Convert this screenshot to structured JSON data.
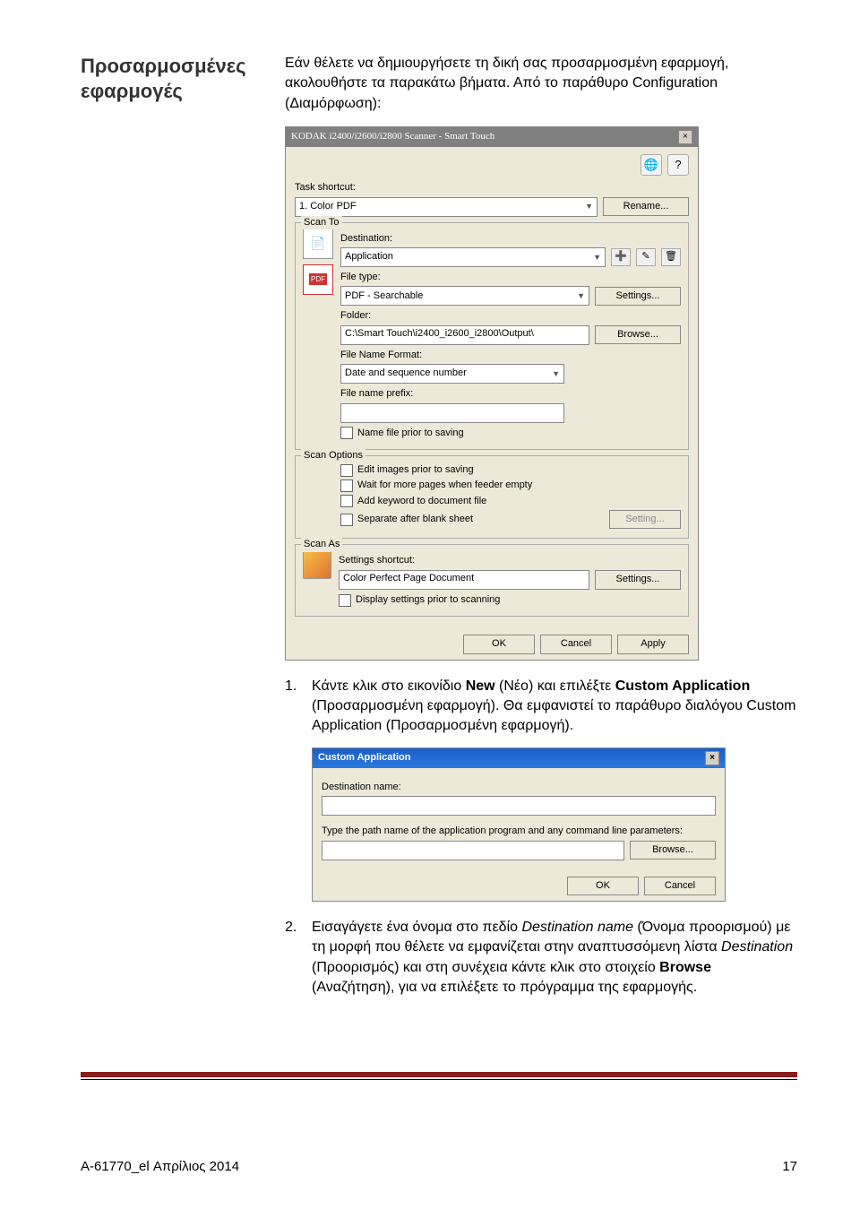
{
  "heading_line1": "Προσαρμοσμένες",
  "heading_line2": "εφαρμογές",
  "intro_p1": "Εάν θέλετε να δημιουργήσετε τη δική σας προσαρμοσμένη εφαρμογή, ακολουθήστε τα παρακάτω βήματα. Από το παράθυρο Configuration (Διαμόρφωση):",
  "step1_num": "1.",
  "step1_text_pre": "Κάντε κλικ στο εικονίδιο ",
  "step1_new": "New",
  "step1_text_mid": " (Νέο) και επιλέξτε ",
  "step1_custom": "Custom Application",
  "step1_text_post": " (Προσαρμοσμένη εφαρμογή). Θα εμφανιστεί το παράθυρο διαλόγου Custom Application (Προσαρμοσμένη εφαρμογή).",
  "step2_num": "2.",
  "step2_text_a": "Εισαγάγετε ένα όνομα στο πεδίο ",
  "step2_em1": "Destination name",
  "step2_text_b": " (Όνομα προορισμού) με τη μορφή που θέλετε να εμφανίζεται στην αναπτυσσόμενη λίστα ",
  "step2_em2": "Destination",
  "step2_text_c": " (Προορισμός) και στη συνέχεια κάντε κλικ στο στοιχείο ",
  "step2_browse": "Browse",
  "step2_text_d": " (Αναζήτηση), για να επιλέξετε το πρόγραμμα της εφαρμογής.",
  "cfg": {
    "title": "KODAK i2400/i2600/i2800 Scanner - Smart Touch",
    "task_shortcut_label": "Task shortcut:",
    "task_shortcut_value": "1. Color PDF",
    "rename_btn": "Rename...",
    "scanto_title": "Scan To",
    "dest_label": "Destination:",
    "dest_value": "Application",
    "filetype_label": "File type:",
    "filetype_value": "PDF - Searchable",
    "settings_btn": "Settings...",
    "folder_label": "Folder:",
    "folder_value": "C:\\Smart Touch\\i2400_i2600_i2800\\Output\\",
    "browse_btn": "Browse...",
    "fnf_label": "File Name Format:",
    "fnf_value": "Date and sequence number",
    "prefix_label": "File name prefix:",
    "name_prior": "Name file prior to saving",
    "scanopts_title": "Scan Options",
    "opt1": "Edit images prior to saving",
    "opt2": "Wait for more pages when feeder empty",
    "opt3": "Add keyword to document file",
    "opt4": "Separate after blank sheet",
    "setting_btn2": "Setting...",
    "scanas_title": "Scan As",
    "settings_shortcut_label": "Settings shortcut:",
    "settings_shortcut_value": "Color Perfect Page Document",
    "display_prior": "Display settings prior to scanning",
    "ok": "OK",
    "cancel": "Cancel",
    "apply": "Apply"
  },
  "dlg": {
    "title": "Custom Application",
    "destname_label": "Destination name:",
    "path_label": "Type the path name of the application program and any command line parameters:",
    "browse_btn": "Browse...",
    "ok": "OK",
    "cancel": "Cancel"
  },
  "footer_left": "A-61770_el  Απρίλιος 2014",
  "footer_right": "17"
}
